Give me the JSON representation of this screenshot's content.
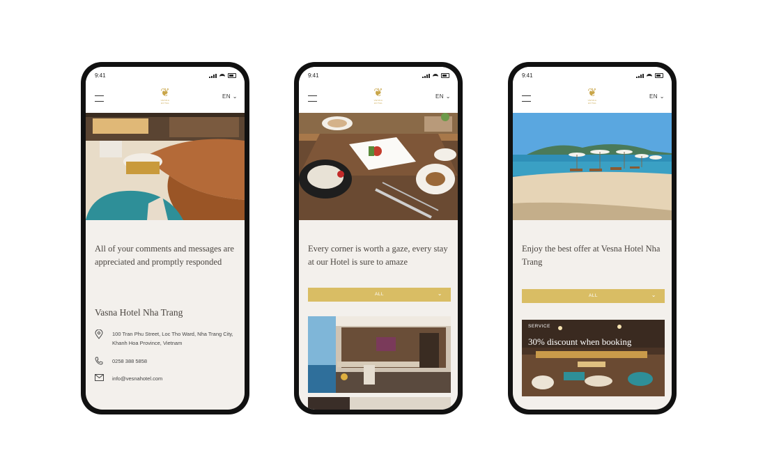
{
  "colors": {
    "accent": "#d9bd64",
    "logo_gold": "#c9a64a",
    "content_bg": "#f3f0ec",
    "phone_frame": "#111111"
  },
  "phones": [
    {
      "status_time": "9:41",
      "lang": "EN",
      "logo_text": "VESNA HOTEL",
      "heading": "All of your comments and messages are appreciated and promptly responded",
      "hotel_name": "Vasna Hotel Nha Trang",
      "contact": {
        "address": "100 Tran Phu Street, Loc Tho Ward, Nha Trang City, Khanh Hoa Province, Vietnam",
        "phone": "0258 388 5858",
        "email": "info@vesnahotel.com"
      }
    },
    {
      "status_time": "9:41",
      "lang": "EN",
      "logo_text": "VESNA HOTEL",
      "heading": "Every corner is worth a gaze, every stay at our Hotel is sure to amaze",
      "filter_label": "ALL"
    },
    {
      "status_time": "9:41",
      "lang": "EN",
      "logo_text": "VESNA HOTEL",
      "heading": "Enjoy the best offer at Vesna Hotel Nha Trang",
      "filter_label": "ALL",
      "service_card": {
        "tag": "SERVICE",
        "title": "30% discount when booking"
      }
    }
  ]
}
